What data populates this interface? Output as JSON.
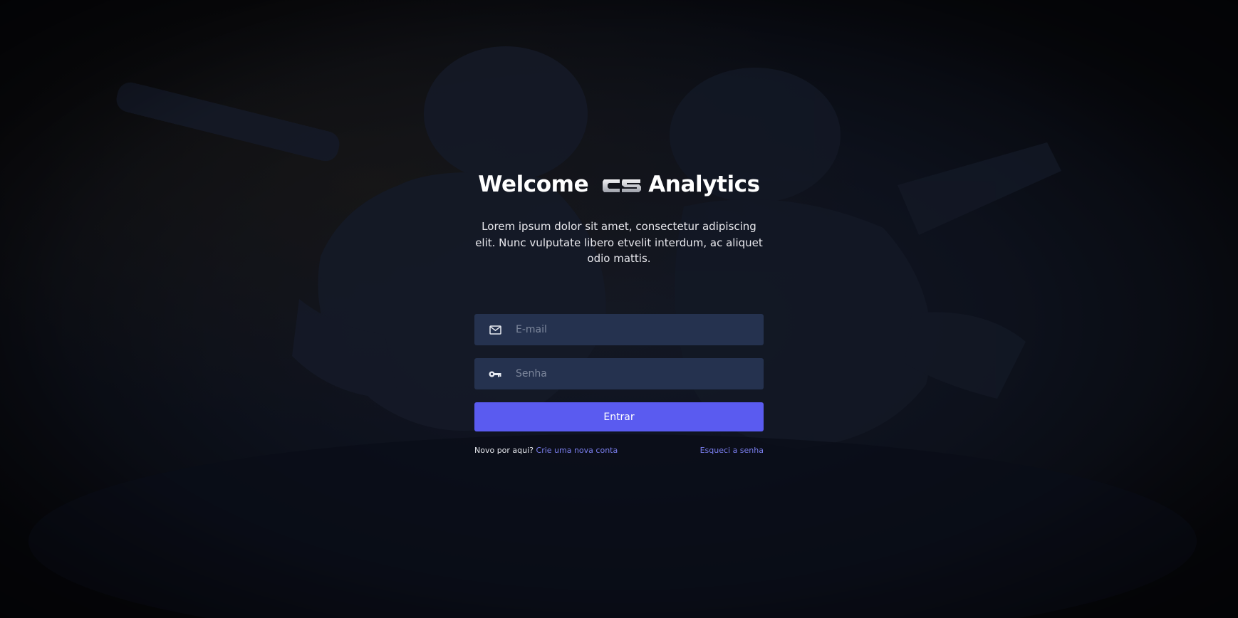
{
  "header": {
    "welcome": "Welcome",
    "logo_text": "CS",
    "brand": "Analytics"
  },
  "subtitle": "Lorem ipsum dolor sit amet, consectetur adipiscing elit. Nunc vulputate libero etvelit interdum, ac aliquet odio mattis.",
  "form": {
    "email": {
      "value": "",
      "placeholder": "E-mail",
      "icon": "mail-icon"
    },
    "password": {
      "value": "",
      "placeholder": "Senha",
      "icon": "key-icon"
    },
    "submit_label": "Entrar"
  },
  "footer": {
    "signup_prompt": "Novo por aqui?",
    "signup_link": "Crie uma nova conta",
    "forgot_link": "Esqueci a senha"
  },
  "colors": {
    "accent": "#5a5bf0",
    "field_bg": "#25324f",
    "link": "#7b7ff0",
    "background": "#07080c"
  }
}
